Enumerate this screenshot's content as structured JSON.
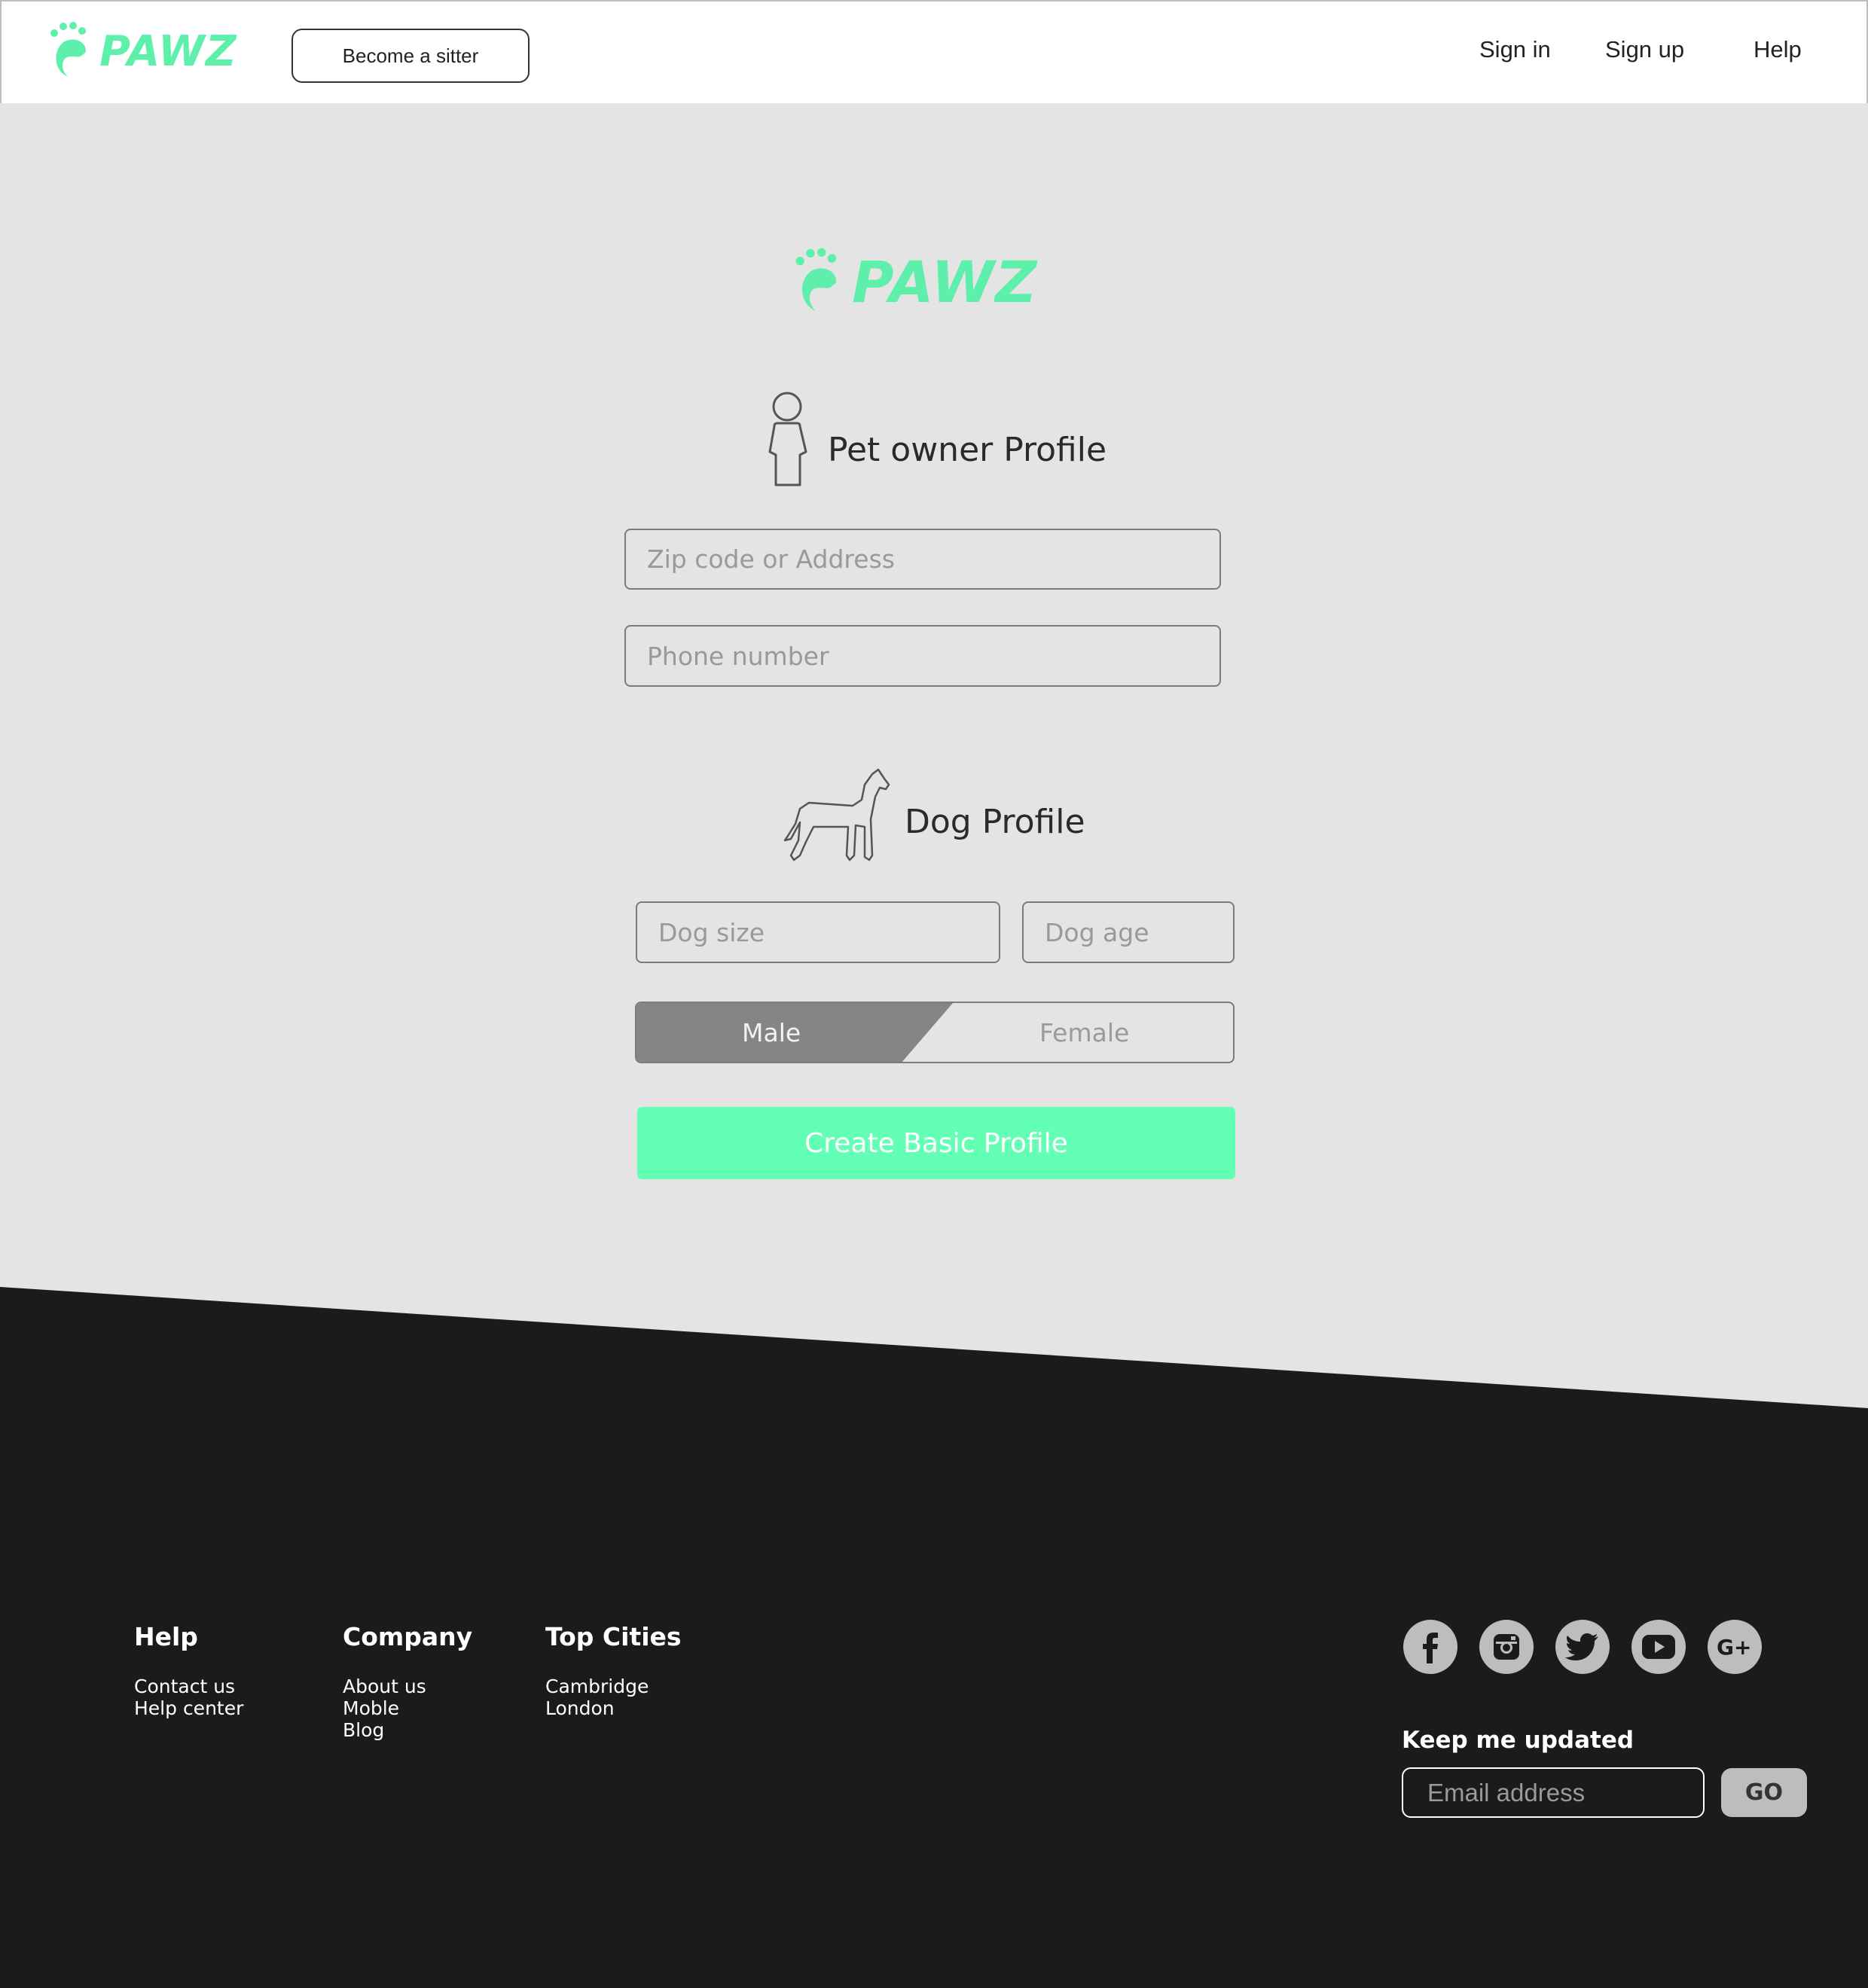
{
  "brand": {
    "name": "PAWZ",
    "accent": "#5ef0ab",
    "button_color": "#63ffb4"
  },
  "header": {
    "become_sitter": "Become a sitter",
    "nav": [
      "Sign in",
      "Sign up",
      "Help"
    ]
  },
  "owner_profile": {
    "title": "Pet owner Profile",
    "icon": "person-icon",
    "fields": {
      "address_placeholder": "Zip code or Address",
      "phone_placeholder": "Phone number"
    }
  },
  "dog_profile": {
    "title": "Dog Profile",
    "icon": "dog-icon",
    "fields": {
      "size_placeholder": "Dog size",
      "age_placeholder": "Dog age"
    },
    "gender": {
      "selected": "Male",
      "options": [
        "Male",
        "Female"
      ]
    }
  },
  "create_button": "Create Basic Profile",
  "footer": {
    "columns": [
      {
        "heading": "Help",
        "links": [
          "Contact us",
          "Help center"
        ]
      },
      {
        "heading": "Company",
        "links": [
          "About us",
          "Moble",
          "Blog"
        ]
      },
      {
        "heading": "Top Cities",
        "links": [
          "Cambridge",
          "London"
        ]
      }
    ],
    "social": [
      "facebook-icon",
      "instagram-icon",
      "twitter-icon",
      "youtube-icon",
      "google-plus-icon"
    ],
    "newsletter": {
      "heading": "Keep me updated",
      "email_placeholder": "Email address",
      "go": "GO"
    }
  }
}
